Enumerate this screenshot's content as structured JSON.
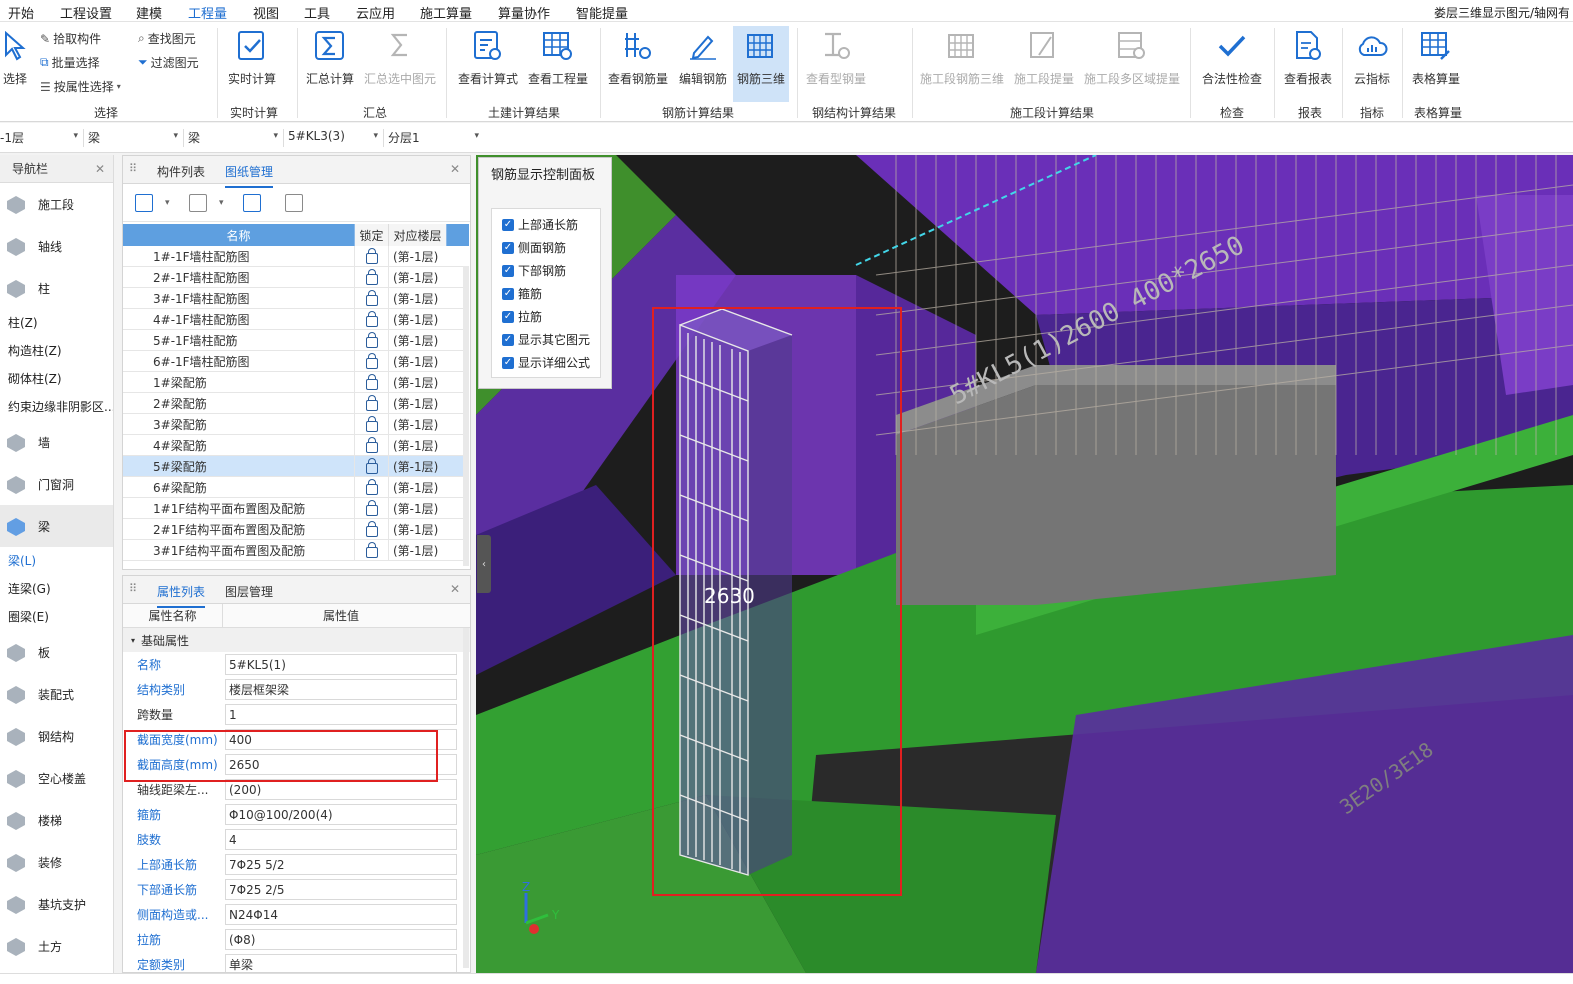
{
  "menu": {
    "items": [
      "开始",
      "工程设置",
      "建模",
      "工程量",
      "视图",
      "工具",
      "云应用",
      "施工算量",
      "算量协作",
      "智能提量"
    ],
    "active_index": 3,
    "window_title": "娄层三维显示图元/轴网有"
  },
  "ribbon": {
    "select_group": {
      "big_label": "选择",
      "pick": "拾取构件",
      "batch": "批量选择",
      "by_attr": "按属性选择",
      "find": "查找图元",
      "filter": "过滤图元",
      "group_label": "选择"
    },
    "realtime": {
      "button": "实时计算",
      "group_label": "实时计算"
    },
    "summary": {
      "button": "汇总计算",
      "button2": "汇总选中图元",
      "group_label": "汇总"
    },
    "civil": {
      "button1": "查看计算式",
      "button2": "查看工程量",
      "group_label": "土建计算结果"
    },
    "rebar": {
      "button1": "查看钢筋量",
      "button2": "编辑钢筋",
      "button3": "钢筋三维",
      "group_label": "钢筋计算结果"
    },
    "steel": {
      "button": "查看型钢量",
      "group_label": "钢结构计算结果"
    },
    "construction": {
      "button1": "施工段钢筋三维",
      "button2": "施工段提量",
      "button3": "施工段多区域提量",
      "group_label": "施工段计算结果"
    },
    "check": {
      "button": "合法性检查",
      "group_label": "检查"
    },
    "report": {
      "button": "查看报表",
      "group_label": "报表"
    },
    "index": {
      "button": "云指标",
      "group_label": "指标"
    },
    "table": {
      "button": "表格算量",
      "group_label": "表格算量"
    }
  },
  "filter": {
    "floor": "-1层",
    "category": "梁",
    "type": "梁",
    "element": "5#KL3(3)",
    "layer": "分层1"
  },
  "nav": {
    "title": "导航栏",
    "items": [
      {
        "label": "施工段",
        "kind": "cat"
      },
      {
        "label": "轴线",
        "kind": "cat"
      },
      {
        "label": "柱",
        "kind": "cat"
      },
      {
        "label": "柱(Z)",
        "kind": "sub"
      },
      {
        "label": "构造柱(Z)",
        "kind": "sub"
      },
      {
        "label": "砌体柱(Z)",
        "kind": "sub"
      },
      {
        "label": "约束边缘非阴影区...",
        "kind": "sub"
      },
      {
        "label": "墙",
        "kind": "cat"
      },
      {
        "label": "门窗洞",
        "kind": "cat"
      },
      {
        "label": "梁",
        "kind": "cat",
        "selected": true
      },
      {
        "label": "梁(L)",
        "kind": "sub",
        "selected": true
      },
      {
        "label": "连梁(G)",
        "kind": "sub"
      },
      {
        "label": "圈梁(E)",
        "kind": "sub"
      },
      {
        "label": "板",
        "kind": "cat"
      },
      {
        "label": "装配式",
        "kind": "cat"
      },
      {
        "label": "钢结构",
        "kind": "cat"
      },
      {
        "label": "空心楼盖",
        "kind": "cat"
      },
      {
        "label": "楼梯",
        "kind": "cat"
      },
      {
        "label": "装修",
        "kind": "cat"
      },
      {
        "label": "基坑支护",
        "kind": "cat"
      },
      {
        "label": "土方",
        "kind": "cat"
      }
    ]
  },
  "drawing_panel": {
    "tab1": "构件列表",
    "tab2": "图纸管理",
    "headers": {
      "name": "名称",
      "lock": "锁定",
      "floor": "对应楼层"
    },
    "rows": [
      {
        "name": "1#-1F墙柱配筋图",
        "floor": "(第-1层)"
      },
      {
        "name": "2#-1F墙柱配筋图",
        "floor": "(第-1层)"
      },
      {
        "name": "3#-1F墙柱配筋图",
        "floor": "(第-1层)"
      },
      {
        "name": "4#-1F墙柱配筋图",
        "floor": "(第-1层)"
      },
      {
        "name": "5#-1F墙柱配筋",
        "floor": "(第-1层)"
      },
      {
        "name": "6#-1F墙柱配筋图",
        "floor": "(第-1层)"
      },
      {
        "name": "1#梁配筋",
        "floor": "(第-1层)"
      },
      {
        "name": "2#梁配筋",
        "floor": "(第-1层)"
      },
      {
        "name": "3#梁配筋",
        "floor": "(第-1层)"
      },
      {
        "name": "4#梁配筋",
        "floor": "(第-1层)"
      },
      {
        "name": "5#梁配筋",
        "floor": "(第-1层)",
        "selected": true
      },
      {
        "name": "6#梁配筋",
        "floor": "(第-1层)"
      },
      {
        "name": "1#1F结构平面布置图及配筋",
        "floor": "(第-1层)"
      },
      {
        "name": "2#1F结构平面布置图及配筋",
        "floor": "(第-1层)"
      },
      {
        "name": "3#1F结构平面布置图及配筋",
        "floor": "(第-1层)"
      }
    ]
  },
  "property_panel": {
    "tab1": "属性列表",
    "tab2": "图层管理",
    "col_name": "属性名称",
    "col_value": "属性值",
    "section": "基础属性",
    "rows": [
      {
        "name": "名称",
        "value": "5#KL5(1)",
        "blue": true
      },
      {
        "name": "结构类别",
        "value": "楼层框架梁",
        "blue": true
      },
      {
        "name": "跨数量",
        "value": "1",
        "blue": false
      },
      {
        "name": "截面宽度(mm)",
        "value": "400",
        "blue": true
      },
      {
        "name": "截面高度(mm)",
        "value": "2650",
        "blue": true
      },
      {
        "name": "轴线距梁左...",
        "value": "(200)",
        "blue": false
      },
      {
        "name": "箍筋",
        "value": "Φ10@100/200(4)",
        "blue": true
      },
      {
        "name": "肢数",
        "value": "4",
        "blue": true
      },
      {
        "name": "上部通长筋",
        "value": "7Φ25 5/2",
        "blue": true
      },
      {
        "name": "下部通长筋",
        "value": "7Φ25 2/5",
        "blue": true
      },
      {
        "name": "侧面构造或...",
        "value": "N24Φ14",
        "blue": true
      },
      {
        "name": "拉筋",
        "value": "(Φ8)",
        "blue": true
      },
      {
        "name": "定额类别",
        "value": "单梁",
        "blue": true
      }
    ]
  },
  "control_panel": {
    "title": "钢筋显示控制面板",
    "options": [
      {
        "label": "上部通长筋",
        "checked": true
      },
      {
        "label": "侧面钢筋",
        "checked": true
      },
      {
        "label": "下部钢筋",
        "checked": true
      },
      {
        "label": "箍筋",
        "checked": true
      },
      {
        "label": "拉筋",
        "checked": true
      },
      {
        "label": "显示其它图元",
        "checked": true
      },
      {
        "label": "显示详细公式",
        "checked": true
      }
    ]
  },
  "viewport": {
    "dimension_text": "2630",
    "beam_label": "5#KL5(1)2600 400*2650",
    "rebar_note": "3E20/3E18",
    "axis_z": "Z",
    "axis_y": "Y"
  }
}
